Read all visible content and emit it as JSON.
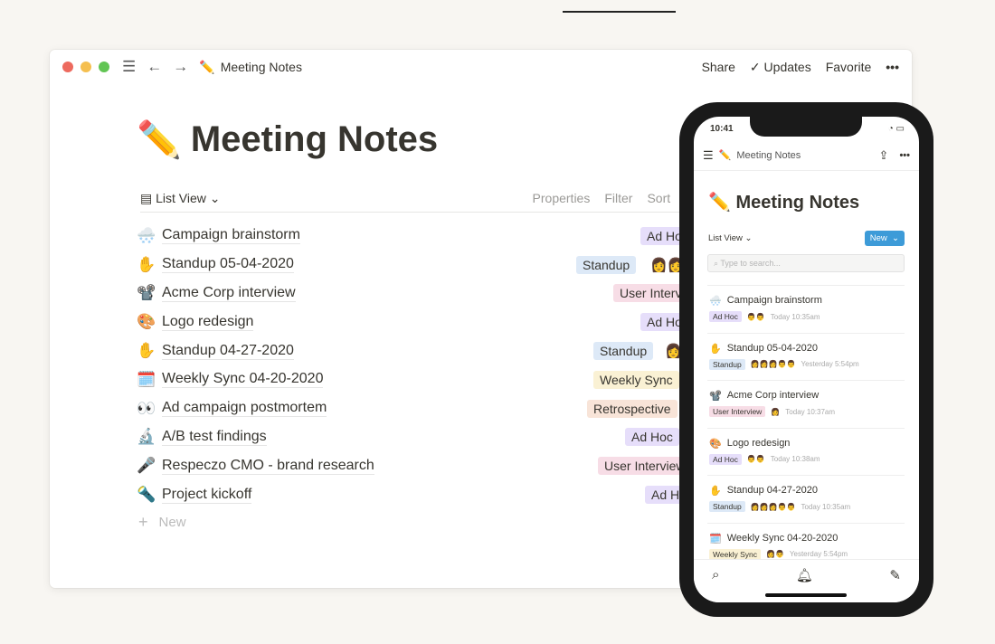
{
  "window": {
    "breadcrumb": "Meeting Notes",
    "page_emoji": "✏️",
    "share": "Share",
    "updates": "Updates",
    "favorite": "Favorite",
    "more": "•••"
  },
  "page": {
    "title": "Meeting Notes",
    "emoji": "✏️",
    "view": "List View",
    "properties": "Properties",
    "filter": "Filter",
    "sort": "Sort",
    "new": "New"
  },
  "rows": [
    {
      "emoji": "🌨️",
      "name": "Campaign brainstorm",
      "tag": "Ad Hoc",
      "color": "#e6defa",
      "avatars": ""
    },
    {
      "emoji": "✋",
      "name": "Standup 05-04-2020",
      "tag": "Standup",
      "color": "#dde9f7",
      "avatars": "👩👩"
    },
    {
      "emoji": "📽️",
      "name": "Acme Corp interview",
      "tag": "User Interview",
      "color": "#f7dde6",
      "avatars": ""
    },
    {
      "emoji": "🎨",
      "name": "Logo redesign",
      "tag": "Ad Hoc",
      "color": "#e6defa",
      "avatars": ""
    },
    {
      "emoji": "✋",
      "name": "Standup 04-27-2020",
      "tag": "Standup",
      "color": "#dde9f7",
      "avatars": "👩"
    },
    {
      "emoji": "🗓️",
      "name": "Weekly Sync 04-20-2020",
      "tag": "Weekly Sync",
      "color": "#faf1d4",
      "avatars": ""
    },
    {
      "emoji": "👀",
      "name": "Ad campaign postmortem",
      "tag": "Retrospective",
      "color": "#f8e4d8",
      "avatars": ""
    },
    {
      "emoji": "🔬",
      "name": "A/B test findings",
      "tag": "Ad Hoc",
      "color": "#e6defa",
      "avatars": ""
    },
    {
      "emoji": "🎤",
      "name": "Respeczo CMO - brand research",
      "tag": "User Interview",
      "color": "#f7dde6",
      "avatars": ""
    },
    {
      "emoji": "🔦",
      "name": "Project kickoff",
      "tag": "Ad Hoc",
      "color": "#e6defa",
      "avatars": ""
    }
  ],
  "phone": {
    "time": "10:41",
    "nav_title": "Meeting Notes",
    "title": "Meeting Notes",
    "view": "List View",
    "new": "New",
    "search_placeholder": "Type to search...",
    "items": [
      {
        "emoji": "🌨️",
        "name": "Campaign brainstorm",
        "tag": "Ad Hoc",
        "color": "#e6defa",
        "avatars": "👨👨",
        "time": "Today 10:35am"
      },
      {
        "emoji": "✋",
        "name": "Standup 05-04-2020",
        "tag": "Standup",
        "color": "#dde9f7",
        "avatars": "👩👩👩👨👨",
        "time": "Yesterday 5:54pm"
      },
      {
        "emoji": "📽️",
        "name": "Acme Corp interview",
        "tag": "User Interview",
        "color": "#f7dde6",
        "avatars": "👩",
        "time": "Today 10:37am"
      },
      {
        "emoji": "🎨",
        "name": "Logo redesign",
        "tag": "Ad Hoc",
        "color": "#e6defa",
        "avatars": "👨👨",
        "time": "Today 10:38am"
      },
      {
        "emoji": "✋",
        "name": "Standup 04-27-2020",
        "tag": "Standup",
        "color": "#dde9f7",
        "avatars": "👩👩👩👨👨",
        "time": "Today 10:35am"
      },
      {
        "emoji": "🗓️",
        "name": "Weekly Sync 04-20-2020",
        "tag": "Weekly Sync",
        "color": "#faf1d4",
        "avatars": "👩👨",
        "time": "Yesterday 5:54pm"
      }
    ]
  }
}
